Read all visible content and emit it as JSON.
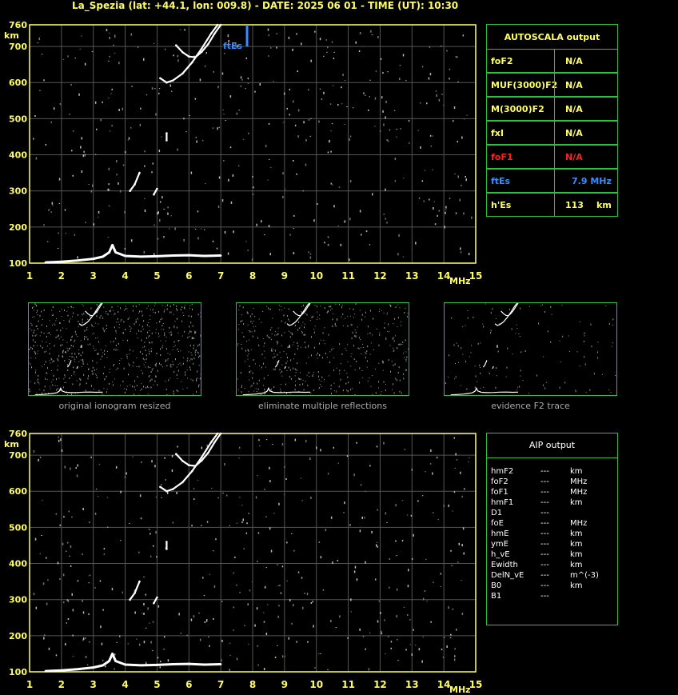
{
  "header": {
    "title": "La_Spezia (lat: +44.1, lon: 009.8) - DATE: 2025 06 01 - TIME (UT): 10:30"
  },
  "ionogram": {
    "y_unit": "km",
    "x_unit": "MHz",
    "fte_label": "ftEs",
    "y_ticks": [
      "760",
      "700",
      "600",
      "500",
      "400",
      "300",
      "200",
      "100"
    ],
    "x_ticks": [
      "1",
      "2",
      "3",
      "4",
      "5",
      "6",
      "7",
      "8",
      "9",
      "10",
      "11",
      "12",
      "13",
      "14",
      "15"
    ]
  },
  "autoscala": {
    "title": "AUTOSCALA output",
    "rows": [
      {
        "key": "foF2",
        "value": "N/A",
        "unit": ""
      },
      {
        "key": "MUF(3000)F2",
        "value": "N/A",
        "unit": ""
      },
      {
        "key": "M(3000)F2",
        "value": "N/A",
        "unit": ""
      },
      {
        "key": "fxI",
        "value": "N/A",
        "unit": ""
      },
      {
        "key": "foF1",
        "value": "N/A",
        "unit": ""
      },
      {
        "key": "ftEs",
        "value": "7.9 MHz",
        "unit": ""
      },
      {
        "key": "h'Es",
        "value": "113",
        "unit": "km"
      }
    ],
    "colors": {
      "default": "#ffff66",
      "foF1": "#ff2020",
      "ftEs": "#3a8cff"
    }
  },
  "thumbnails": {
    "captions": [
      "original ionogram resized",
      "eliminate multiple reflections",
      "evidence F2 trace"
    ]
  },
  "aip": {
    "title": "AIP output",
    "rows": [
      {
        "param": "hmF2",
        "value": "---",
        "unit": "km"
      },
      {
        "param": "foF2",
        "value": "---",
        "unit": "MHz"
      },
      {
        "param": "foF1",
        "value": "---",
        "unit": "MHz"
      },
      {
        "param": "hmF1",
        "value": "---",
        "unit": "km"
      },
      {
        "param": "D1",
        "value": "---",
        "unit": ""
      },
      {
        "param": "foE",
        "value": "---",
        "unit": "MHz"
      },
      {
        "param": "hmE",
        "value": "---",
        "unit": "km"
      },
      {
        "param": "ymE",
        "value": "---",
        "unit": "km"
      },
      {
        "param": "h_vE",
        "value": "---",
        "unit": "km"
      },
      {
        "param": "Ewidth",
        "value": "---",
        "unit": "km"
      },
      {
        "param": "DelN_vE",
        "value": "---",
        "unit": "m^(-3)"
      },
      {
        "param": "B0",
        "value": "---",
        "unit": "km"
      },
      {
        "param": "B1",
        "value": "---",
        "unit": ""
      }
    ]
  },
  "chart_data": {
    "type": "scatter",
    "title": "La_Spezia (lat: +44.1, lon: 009.8) - DATE: 2025 06 01 - TIME (UT): 10:30",
    "xlabel": "MHz",
    "ylabel": "km",
    "xlim": [
      1,
      15
    ],
    "ylim": [
      100,
      760
    ],
    "grid": true,
    "series": [
      {
        "values": [
          [
            1.5,
            102
          ],
          [
            2.0,
            104
          ],
          [
            2.5,
            107
          ],
          [
            3.0,
            112
          ],
          [
            3.3,
            118
          ],
          [
            3.5,
            130
          ],
          [
            3.6,
            150
          ],
          [
            3.7,
            130
          ],
          [
            4.0,
            120
          ],
          [
            4.5,
            118
          ],
          [
            5.0,
            119
          ],
          [
            5.5,
            121
          ],
          [
            6.0,
            122
          ],
          [
            6.5,
            120
          ],
          [
            7.0,
            121
          ]
        ]
      },
      {
        "values": [
          [
            5.1,
            612
          ],
          [
            5.3,
            600
          ],
          [
            5.5,
            606
          ],
          [
            5.8,
            625
          ],
          [
            6.1,
            656
          ],
          [
            6.4,
            694
          ],
          [
            6.7,
            736
          ],
          [
            6.9,
            760
          ]
        ]
      },
      {
        "values": [
          [
            5.6,
            703
          ],
          [
            5.8,
            684
          ],
          [
            6.0,
            672
          ],
          [
            6.2,
            670
          ],
          [
            6.4,
            685
          ],
          [
            6.6,
            706
          ],
          [
            6.8,
            735
          ],
          [
            7.0,
            760
          ]
        ]
      },
      {
        "values": [
          [
            4.15,
            300
          ],
          [
            4.3,
            318
          ],
          [
            4.45,
            350
          ]
        ]
      },
      {
        "values": [
          [
            4.9,
            290
          ],
          [
            5.0,
            306
          ]
        ]
      },
      {
        "values": [
          [
            5.3,
            440
          ],
          [
            5.3,
            460
          ]
        ]
      }
    ],
    "markers": [
      {
        "name": "ftEs",
        "x": 7.9
      }
    ]
  }
}
